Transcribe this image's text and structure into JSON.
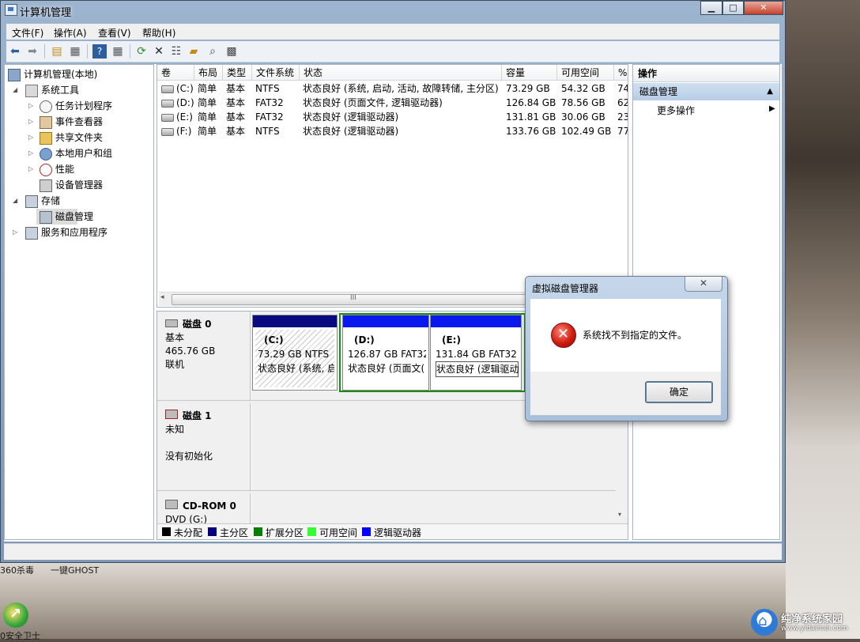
{
  "window": {
    "title": "计算机管理"
  },
  "menu": [
    "文件(F)",
    "操作(A)",
    "查看(V)",
    "帮助(H)"
  ],
  "tree": [
    {
      "label": "计算机管理(本地)",
      "icon": "computer-management-icon"
    },
    {
      "label": "系统工具",
      "icon": "tools-icon"
    },
    {
      "label": "任务计划程序",
      "icon": "clock-icon"
    },
    {
      "label": "事件查看器",
      "icon": "event-viewer-icon"
    },
    {
      "label": "共享文件夹",
      "icon": "shared-folder-icon"
    },
    {
      "label": "本地用户和组",
      "icon": "users-icon"
    },
    {
      "label": "性能",
      "icon": "performance-icon"
    },
    {
      "label": "设备管理器",
      "icon": "device-manager-icon"
    },
    {
      "label": "存储",
      "icon": "storage-icon"
    },
    {
      "label": "磁盘管理",
      "icon": "disk-management-icon"
    },
    {
      "label": "服务和应用程序",
      "icon": "services-icon"
    }
  ],
  "volumes": {
    "headers": [
      "卷",
      "布局",
      "类型",
      "文件系统",
      "状态",
      "容量",
      "可用空间",
      "%"
    ],
    "rows": [
      [
        "(C:)",
        "简单",
        "基本",
        "NTFS",
        "状态良好 (系统, 启动, 活动, 故障转储, 主分区)",
        "73.29 GB",
        "54.32 GB",
        "74"
      ],
      [
        "(D:)",
        "简单",
        "基本",
        "FAT32",
        "状态良好 (页面文件, 逻辑驱动器)",
        "126.84 GB",
        "78.56 GB",
        "62"
      ],
      [
        "(E:)",
        "简单",
        "基本",
        "FAT32",
        "状态良好 (逻辑驱动器)",
        "131.81 GB",
        "30.06 GB",
        "23"
      ],
      [
        "(F:)",
        "简单",
        "基本",
        "NTFS",
        "状态良好 (逻辑驱动器)",
        "133.76 GB",
        "102.49 GB",
        "77"
      ]
    ],
    "scroll_mark": "III"
  },
  "disks": [
    {
      "name": "磁盘 0",
      "type": "基本",
      "size": "465.76 GB",
      "state": "联机",
      "partitions": [
        {
          "label": "(C:)",
          "info": "73.29 GB NTFS",
          "status": "状态良好 (系统, 启"
        },
        {
          "label": "(D:)",
          "info": "126.87 GB FAT32",
          "status": "状态良好 (页面文("
        },
        {
          "label": "(E:)",
          "info": "131.84 GB FAT32",
          "status": "状态良好 (逻辑驱动器"
        }
      ]
    },
    {
      "name": "磁盘 1",
      "type": "未知",
      "state": "没有初始化"
    },
    {
      "name": "CD-ROM 0",
      "type": "DVD (G:)"
    }
  ],
  "legend": [
    {
      "label": "未分配",
      "color": "#000000"
    },
    {
      "label": "主分区",
      "color": "#000080"
    },
    {
      "label": "扩展分区",
      "color": "#008000"
    },
    {
      "label": "可用空间",
      "color": "#33ff33"
    },
    {
      "label": "逻辑驱动器",
      "color": "#0000ff"
    }
  ],
  "actions": {
    "header": "操作",
    "section": "磁盘管理",
    "more": "更多操作"
  },
  "dialog": {
    "title": "虚拟磁盘管理器",
    "message": "系统找不到指定的文件。",
    "ok": "确定",
    "close": "✕"
  },
  "desktop": {
    "icon1": "360杀毒",
    "icon2": "一键GHOST",
    "icon3": "0安全卫士"
  },
  "watermark": {
    "title": "纯净系统家园",
    "url": "www.yidaimei.com"
  }
}
